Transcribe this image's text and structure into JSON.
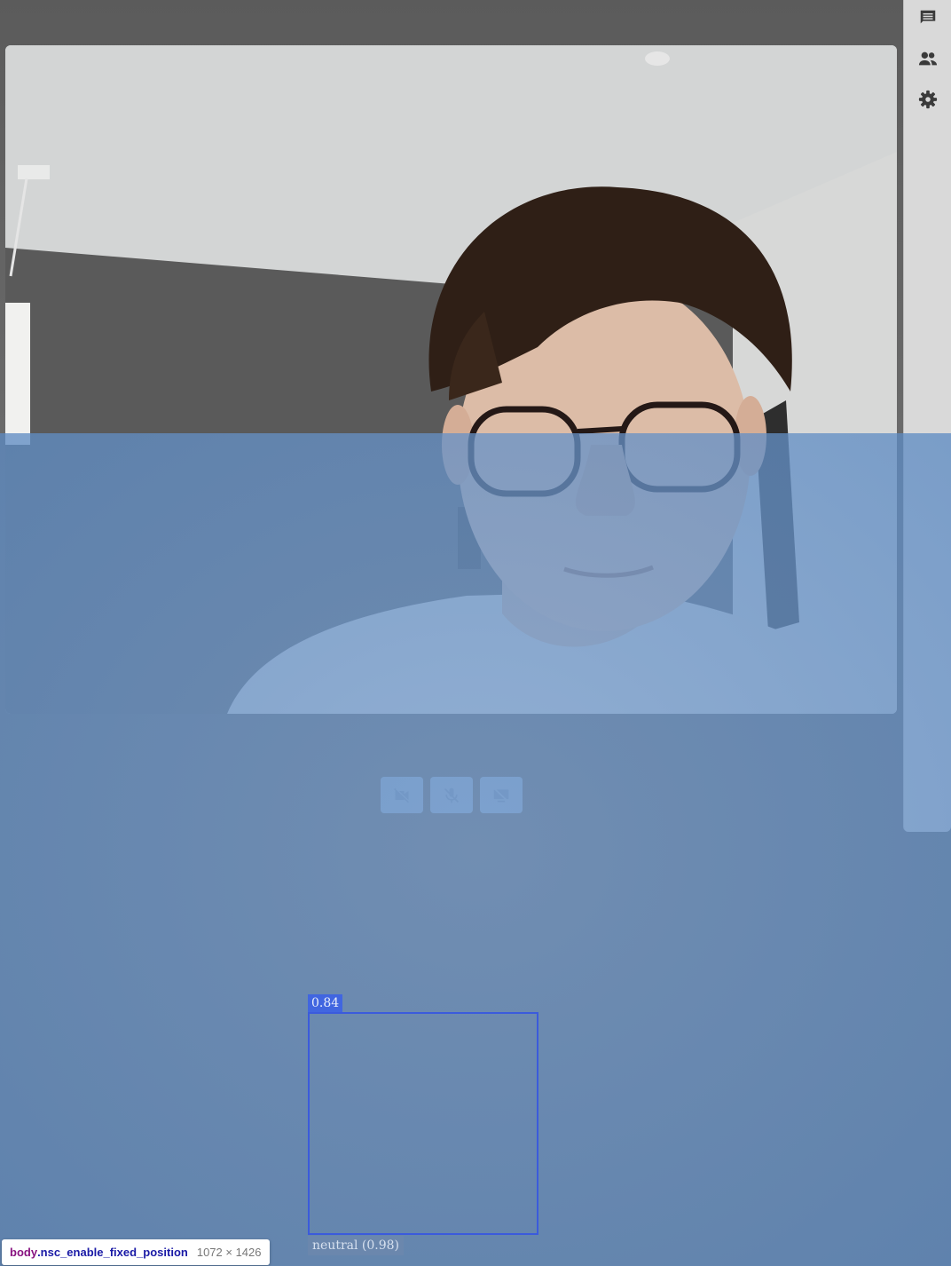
{
  "sidebar": {
    "buttons": [
      {
        "icon": "chat-icon"
      },
      {
        "icon": "participants-icon"
      },
      {
        "icon": "settings-gear-icon"
      }
    ]
  },
  "controls": {
    "buttons": [
      {
        "icon": "camera-off-icon"
      },
      {
        "icon": "mic-off-icon"
      },
      {
        "icon": "screen-share-off-icon"
      }
    ]
  },
  "face_detection": {
    "score": "0.84",
    "emotion": "neutral (0.98)"
  },
  "devtools_tooltip": {
    "tag": "body",
    "classname": ".nsc_enable_fixed_position",
    "dimensions": "1072 × 1426"
  },
  "colors": {
    "overlay": "#7aa0cc",
    "box": "#3b5bdc",
    "panel": "#d9d9d9"
  }
}
